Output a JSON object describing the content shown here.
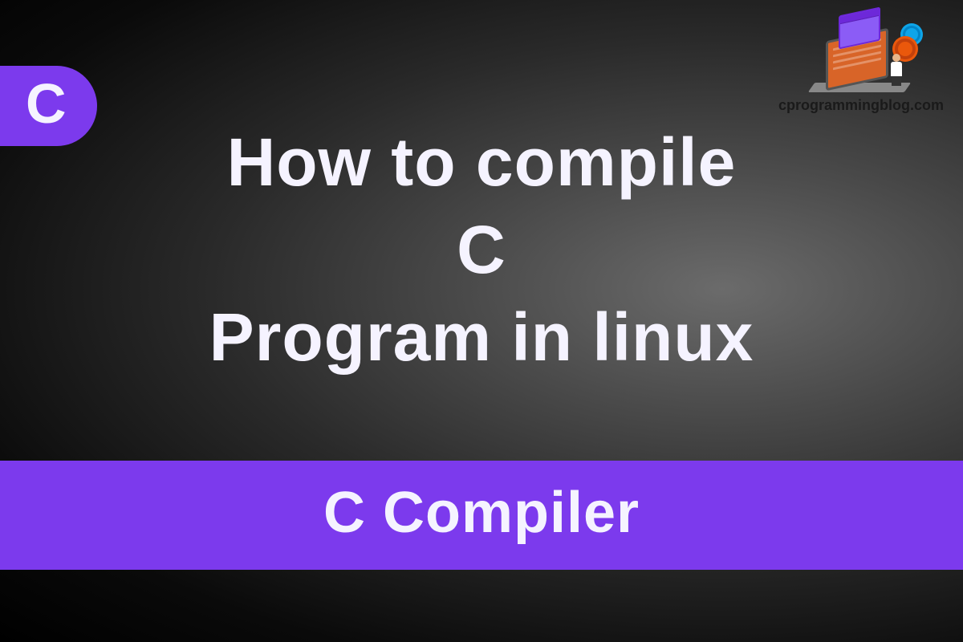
{
  "badge": {
    "letter": "C"
  },
  "header": {
    "site_name": "cprogrammingblog.com"
  },
  "title": {
    "line1": "How to compile",
    "line2": "C",
    "line3": "Program in linux"
  },
  "subtitle": {
    "text": "C Compiler"
  },
  "colors": {
    "accent": "#7c3aed",
    "text": "#f5f3ff",
    "logo_orange": "#d86428",
    "logo_purple": "#8b5cf6"
  }
}
